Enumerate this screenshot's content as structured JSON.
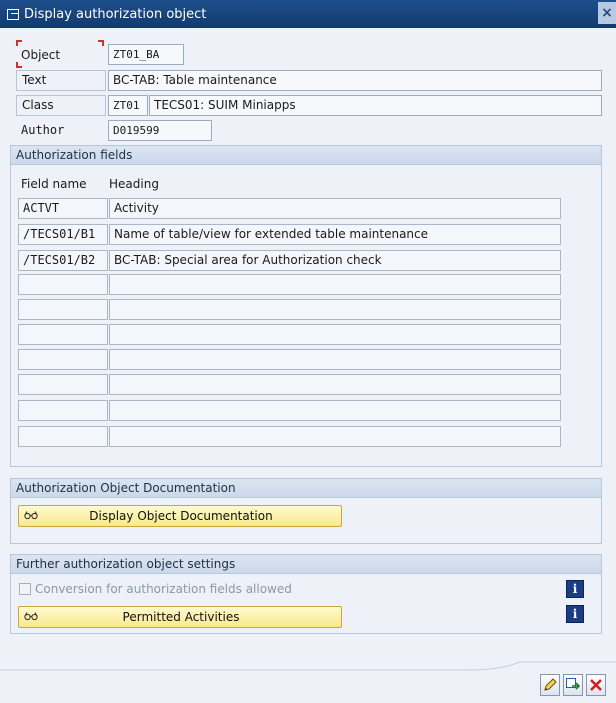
{
  "window": {
    "title": "Display authorization object",
    "close_glyph": "×"
  },
  "header_fields": {
    "object_label": "Object",
    "object_value": "ZT01_BA",
    "text_label": "Text",
    "text_value": "BC-TAB: Table maintenance",
    "class_label": "Class",
    "class_code": "ZT01",
    "class_desc": "TECS01: SUIM Miniapps",
    "author_label": "Author",
    "author_value": "D019599"
  },
  "auth_fields": {
    "title": "Authorization fields",
    "col_field": "Field name",
    "col_heading": "Heading",
    "rows": [
      {
        "field": "ACTVT",
        "heading": "Activity"
      },
      {
        "field": "/TECS01/B1",
        "heading": "Name of table/view for extended table maintenance"
      },
      {
        "field": "/TECS01/B2",
        "heading": "BC-TAB: Special area for Authorization check"
      },
      {
        "field": "",
        "heading": ""
      },
      {
        "field": "",
        "heading": ""
      },
      {
        "field": "",
        "heading": ""
      },
      {
        "field": "",
        "heading": ""
      },
      {
        "field": "",
        "heading": ""
      },
      {
        "field": "",
        "heading": ""
      },
      {
        "field": "",
        "heading": ""
      }
    ]
  },
  "documentation": {
    "title": "Authorization Object Documentation",
    "button_label": "Display Object Documentation",
    "button_icon": "glasses-icon"
  },
  "further_settings": {
    "title": "Further authorization object settings",
    "conversion_label": "Conversion for authorization fields allowed",
    "conversion_checked": false,
    "permitted_label": "Permitted Activities",
    "info_glyph": "i"
  },
  "toolbar": {
    "icons": [
      "edit-pencil-icon",
      "navigate-icon",
      "cancel-icon"
    ]
  }
}
